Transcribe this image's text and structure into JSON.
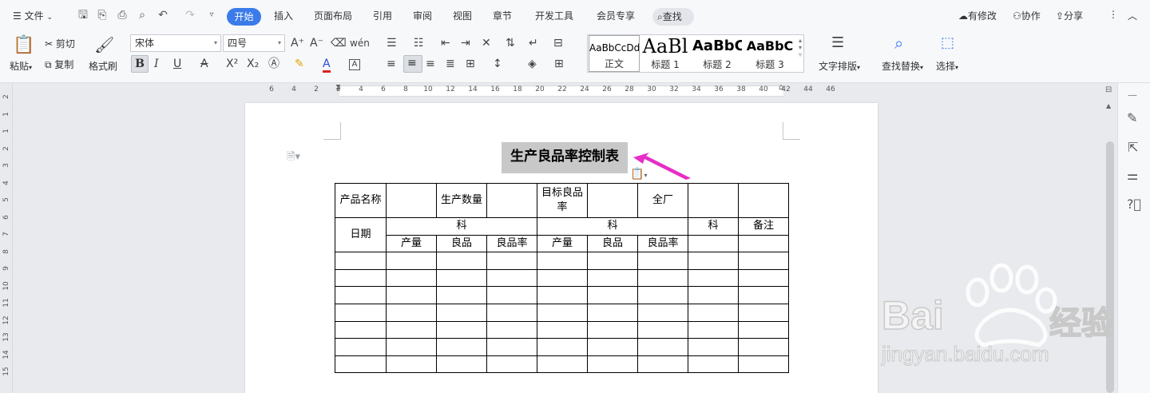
{
  "menubar": {
    "file_label": "文件",
    "tabs": [
      "开始",
      "插入",
      "页面布局",
      "引用",
      "审阅",
      "视图",
      "章节",
      "开发工具",
      "会员专享"
    ],
    "search_label": "查找",
    "right": {
      "changes": "有修改",
      "collab": "协作",
      "share": "分享"
    }
  },
  "ribbon": {
    "paste": "粘贴",
    "cut": "剪切",
    "copy": "复制",
    "format_painter": "格式刷",
    "font_name": "宋体",
    "font_size": "四号",
    "styles": [
      {
        "preview": "AaBbCcDd",
        "name": "正文"
      },
      {
        "preview": "AaBl",
        "name": "标题 1"
      },
      {
        "preview": "AaBbC",
        "name": "标题 2"
      },
      {
        "preview": "AaBbC",
        "name": "标题 3"
      }
    ],
    "text_layout": "文字排版",
    "find_replace": "查找替换",
    "select": "选择"
  },
  "ruler": {
    "h_labels": [
      "6",
      "4",
      "2",
      "2",
      "4",
      "6",
      "8",
      "10",
      "12",
      "14",
      "16",
      "18",
      "20",
      "22",
      "24",
      "26",
      "28",
      "30",
      "32",
      "34",
      "36",
      "38",
      "40",
      "42",
      "44",
      "46"
    ],
    "v_labels": [
      "2",
      "1",
      "1",
      "2",
      "3",
      "4",
      "5",
      "6",
      "7",
      "8",
      "9",
      "10",
      "11",
      "12",
      "13",
      "14",
      "15"
    ]
  },
  "document": {
    "title": "生产良品率控制表",
    "table": {
      "r1": [
        "产品名称",
        "",
        "生产数量",
        "",
        "目标良品率",
        "",
        "全厂",
        "",
        ""
      ],
      "r2": [
        "日期",
        "科",
        "科",
        "科",
        "备注"
      ],
      "r3": [
        "产量",
        "良品",
        "良品率",
        "产量",
        "良品",
        "良品率"
      ]
    }
  },
  "watermark": {
    "brand": "Bai",
    "brand_cn": "经验",
    "url": "jingyan.baidu.com"
  },
  "colors": {
    "accent": "#3b7be9",
    "arrow": "#e62ec8",
    "selection": "#c8c8c8"
  }
}
